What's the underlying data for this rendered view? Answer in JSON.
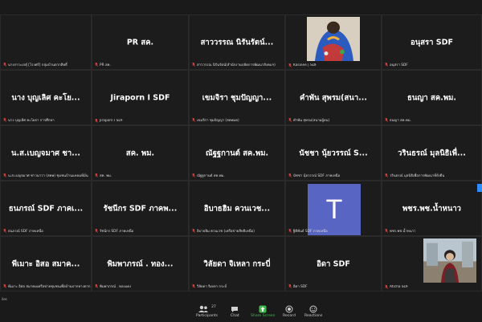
{
  "tiles": [
    {
      "main": "",
      "label": "นางการะเกตุ์ [โรงศรี] กลุ่มบ้านตากสิทธิ์",
      "photo": false
    },
    {
      "main": "PR สค.",
      "label": "PR สค.",
      "photo": false
    },
    {
      "main": "สาววรรณ นิรันรัตน์...",
      "label": "สาววรรณ นิรันรัตน์(สำนักงานปลัดการพัฒนาสังคมฯ)",
      "photo": false
    },
    {
      "main": "",
      "label": "Kasinee | SDF",
      "photo": "art"
    },
    {
      "main": "อนุสรา SDF",
      "label": "อนุสรา SDF",
      "photo": false
    },
    {
      "main": "นาง บุญเลิศ คะโย...",
      "label": "นาง บุญเลิศ คะโยธา การศึกษา",
      "photo": false
    },
    {
      "main": "Jiraporn I SDF",
      "label": "Jiraporn I SDF",
      "photo": false
    },
    {
      "main": "เขมจิรา ชุมปัญญา...",
      "label": "เขมจิรา ชุมปัญญา (สคพมด)",
      "photo": false
    },
    {
      "main": "คำพัน สุพรม(สนา...",
      "label": "คำพัน สุพรม(สนามผู้ยน)",
      "photo": false
    },
    {
      "main": "ธนญา  สค.พม.",
      "label": "ธนญา  สค.พม.",
      "photo": false
    },
    {
      "main": "น.ส.เบญจมาศ ชา...",
      "label": "น.ส.เบญจมาศ ชาวนาวา (สคพ) ชุมชนบ้านแหลมที่มั่น",
      "photo": false
    },
    {
      "main": "สค. พม.",
      "label": "สค. พม.",
      "photo": false
    },
    {
      "main": "ณัฐฐกานต์ สค.พม.",
      "label": "ณัฐฐกานต์ สค.พม.",
      "photo": false
    },
    {
      "main": "นัชชา นุ้ยวรรณ์ S...",
      "label": "นัชชา นุ้ยวรรณ์ SDF ภาคเหนือ",
      "photo": false
    },
    {
      "main": "วรินธรณ์ มุลนิธิเพื่...",
      "label": "วรินธรณ์ มุลนิธิเพื่อการพัฒนาที่ยั่งยืน",
      "photo": false
    },
    {
      "main": "ธนภรณ์ SDF ภาคเ...",
      "label": "ธนภรณ์ SDF ภาคเหนือ",
      "photo": false
    },
    {
      "main": "รัชนีกร SDF ภาคพ...",
      "label": "รัชนีกร SDF ภาคเหนือ",
      "photo": false
    },
    {
      "main": "อิบาธฮิม ควนเวช...",
      "label": "อิบาธฮิม ควนเวช (เครือข่ายสิทธิเหนือ)",
      "photo": false
    },
    {
      "main": "",
      "label": "ฐิติพันธ์ SDF ภาคเหนือ",
      "photo": "T"
    },
    {
      "main": "พชร.พช.น้ำหนาว",
      "label": "พชร.พช.น้ำหนาว",
      "photo": false
    },
    {
      "main": "พีเมาะ อิสอ สมาค...",
      "label": "พีเมาะ อิสอ สมาคมเครือข่ายชุมชนเพื่อบ้านปากทางตาก",
      "photo": false
    },
    {
      "main": "พิมพาภรณ์ . ทอง...",
      "label": "พิมพาภรณ์ . ทองแดง",
      "photo": false
    },
    {
      "main": "วิลัยดา จิเหลา กระบี่",
      "label": "วิลัยดา จิเหลา กระบี่",
      "photo": false
    },
    {
      "main": "อิดา SDF",
      "label": "อิดา SDF",
      "photo": false
    },
    {
      "main": "",
      "label": "Aticha SDF",
      "photo": "person"
    }
  ],
  "toolbar": {
    "participants_count": "27",
    "participants": "Participants",
    "chat": "Chat",
    "share": "Share Screen",
    "record": "Record",
    "reactions": "Reactions"
  },
  "left_text": "iles",
  "colors": {
    "tile_bg": "#1c1c1c",
    "avatar_T": "#5865c2",
    "share_green": "#3fb950",
    "edge_button": "#2d8cff"
  }
}
